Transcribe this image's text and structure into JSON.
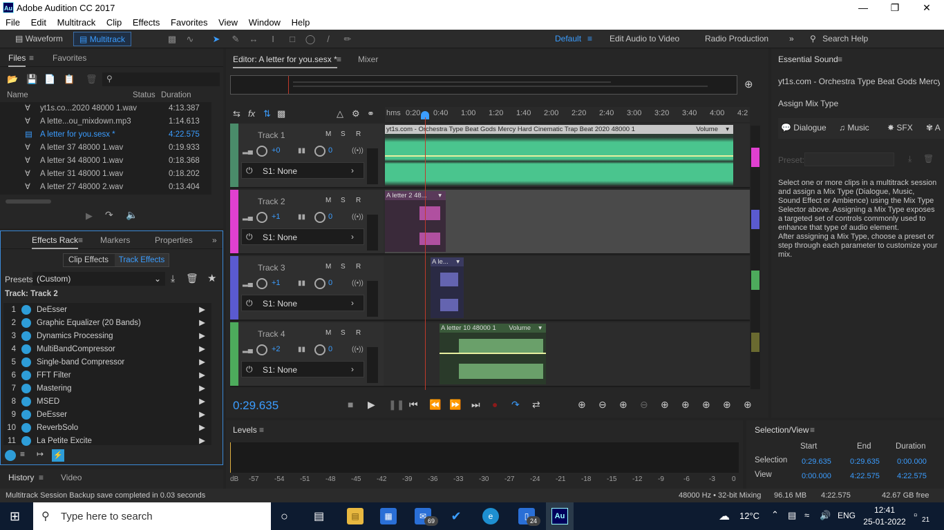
{
  "window": {
    "title": "Adobe Audition CC 2017",
    "app_icon": "Au"
  },
  "menu": [
    "File",
    "Edit",
    "Multitrack",
    "Clip",
    "Effects",
    "Favorites",
    "View",
    "Window",
    "Help"
  ],
  "toolbar": {
    "waveform": "Waveform",
    "multitrack": "Multitrack",
    "workspaces": [
      "Default",
      "Edit Audio to Video",
      "Radio Production"
    ],
    "search_placeholder": "Search Help"
  },
  "files": {
    "tabs": [
      "Files",
      "Favorites"
    ],
    "columns": [
      "Name",
      "Status",
      "Duration"
    ],
    "rows": [
      {
        "name": "yt1s.co...2020 48000 1.wav",
        "duration": "4:13.387"
      },
      {
        "name": "A lette...ou_mixdown.mp3",
        "duration": "1:14.613"
      },
      {
        "name": "A letter for you.sesx *",
        "duration": "4:22.575"
      },
      {
        "name": "A letter 37 48000 1.wav",
        "duration": "0:19.933"
      },
      {
        "name": "A letter 34 48000 1.wav",
        "duration": "0:18.368"
      },
      {
        "name": "A letter 31 48000 1.wav",
        "duration": "0:18.202"
      },
      {
        "name": "A letter 27 48000 2.wav",
        "duration": "0:13.404"
      }
    ]
  },
  "effects_rack": {
    "tabs": [
      "Effects Rack",
      "Markers",
      "Properties"
    ],
    "subtabs": [
      "Clip Effects",
      "Track Effects"
    ],
    "presets_label": "Presets:",
    "preset_value": "(Custom)",
    "track_label": "Track: Track 2",
    "effects": [
      {
        "n": "1",
        "name": "DeEsser"
      },
      {
        "n": "2",
        "name": "Graphic Equalizer (20 Bands)"
      },
      {
        "n": "3",
        "name": "Dynamics Processing"
      },
      {
        "n": "4",
        "name": "MultiBandCompressor"
      },
      {
        "n": "5",
        "name": "Single-band Compressor"
      },
      {
        "n": "6",
        "name": "FFT Filter"
      },
      {
        "n": "7",
        "name": "Mastering"
      },
      {
        "n": "8",
        "name": "MSED"
      },
      {
        "n": "9",
        "name": "DeEsser"
      },
      {
        "n": "10",
        "name": "ReverbSolo"
      },
      {
        "n": "11",
        "name": "La Petite Excite"
      }
    ]
  },
  "history": {
    "tabs": [
      "History",
      "Video"
    ]
  },
  "editor": {
    "tab": "Editor: A letter for you.sesx *",
    "mixer": "Mixer",
    "ruler": [
      "hms",
      "0:20",
      "0:40",
      "1:00",
      "1:20",
      "1:40",
      "2:00",
      "2:20",
      "2:40",
      "3:00",
      "3:20",
      "3:40",
      "4:00",
      "4:2"
    ],
    "time": "0:29.635",
    "tracks": [
      {
        "name": "Track 1",
        "vol": "+0",
        "pan": "0",
        "send": "S1: None",
        "color": "#4dd498",
        "clip": "yt1s.com - Orchestra Type Beat Gods Mercy  Hard Cinematic Trap Beat 2020 48000 1",
        "clip_extra": "Volume"
      },
      {
        "name": "Track 2",
        "vol": "+1",
        "pan": "0",
        "send": "S1: None",
        "color": "#e040d0",
        "clip": "A letter 2 48...",
        "clip_extra": ""
      },
      {
        "name": "Track 3",
        "vol": "+1",
        "pan": "0",
        "send": "S1: None",
        "color": "#5a5ad0",
        "clip": "A le...",
        "clip_extra": ""
      },
      {
        "name": "Track 4",
        "vol": "+2",
        "pan": "0",
        "send": "S1: None",
        "color": "#4dab5c",
        "clip": "A letter 10 48000 1",
        "clip_extra": "Volume"
      }
    ],
    "msr": [
      "M",
      "S",
      "R"
    ]
  },
  "essential_sound": {
    "title": "Essential Sound",
    "clip_name": "yt1s.com - Orchestra Type Beat Gods Mercy ...",
    "assign_label": "Assign Mix Type",
    "types": [
      "Dialogue",
      "Music",
      "SFX",
      "A"
    ],
    "preset_label": "Preset:",
    "help1": "Select one or more clips in a multitrack session and assign a Mix Type (Dialogue, Music, Sound Effect or Ambience) using the Mix Type Selector above. Assigning a Mix Type exposes a targeted set of controls commonly used to enhance that type of audio element.",
    "help2": "After assigning a Mix Type, choose a preset or step through each parameter to customize your mix."
  },
  "levels": {
    "title": "Levels",
    "scale": [
      "dB",
      "-57",
      "-54",
      "-51",
      "-48",
      "-45",
      "-42",
      "-39",
      "-36",
      "-33",
      "-30",
      "-27",
      "-24",
      "-21",
      "-18",
      "-15",
      "-12",
      "-9",
      "-6",
      "-3",
      "0"
    ]
  },
  "selection_view": {
    "title": "Selection/View",
    "headers": [
      "Start",
      "End",
      "Duration"
    ],
    "selection_label": "Selection",
    "selection": [
      "0:29.635",
      "0:29.635",
      "0:00.000"
    ],
    "view_label": "View",
    "view": [
      "0:00.000",
      "4:22.575",
      "4:22.575"
    ]
  },
  "status": {
    "message": "Multitrack Session Backup save completed in 0.03 seconds",
    "format": "48000 Hz • 32-bit Mixing",
    "mem": "96.16 MB",
    "dur": "4:22.575",
    "free": "42.67 GB free"
  },
  "taskbar": {
    "search_placeholder": "Type here to search",
    "mail_badge": "69",
    "phone_badge": "24",
    "temp": "12°C",
    "lang": "ENG",
    "time": "12:41",
    "date": "25-01-2022",
    "notif": "21"
  }
}
